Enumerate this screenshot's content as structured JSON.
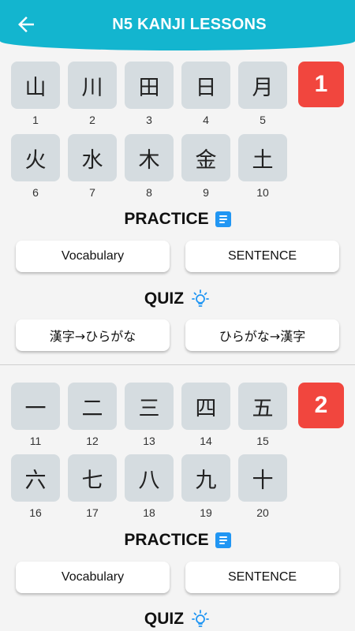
{
  "header": {
    "title": "N5 KANJI LESSONS",
    "back_icon": "arrow-left-icon",
    "color": "#13b5cf"
  },
  "lessons": [
    {
      "badge": "1",
      "kanji": [
        {
          "char": "山",
          "num": "1"
        },
        {
          "char": "川",
          "num": "2"
        },
        {
          "char": "田",
          "num": "3"
        },
        {
          "char": "日",
          "num": "4"
        },
        {
          "char": "月",
          "num": "5"
        },
        {
          "char": "火",
          "num": "6"
        },
        {
          "char": "水",
          "num": "7"
        },
        {
          "char": "木",
          "num": "8"
        },
        {
          "char": "金",
          "num": "9"
        },
        {
          "char": "土",
          "num": "10"
        }
      ],
      "practice_label": "PRACTICE",
      "vocab_label": "Vocabulary",
      "sentence_label": "SENTENCE",
      "quiz_label": "QUIZ",
      "quiz_kanji_to_kana": "漢字→ひらがな",
      "quiz_kana_to_kanji": "ひらがな→漢字"
    },
    {
      "badge": "2",
      "kanji": [
        {
          "char": "一",
          "num": "11"
        },
        {
          "char": "二",
          "num": "12"
        },
        {
          "char": "三",
          "num": "13"
        },
        {
          "char": "四",
          "num": "14"
        },
        {
          "char": "五",
          "num": "15"
        },
        {
          "char": "六",
          "num": "16"
        },
        {
          "char": "七",
          "num": "17"
        },
        {
          "char": "八",
          "num": "18"
        },
        {
          "char": "九",
          "num": "19"
        },
        {
          "char": "十",
          "num": "20"
        }
      ],
      "practice_label": "PRACTICE",
      "vocab_label": "Vocabulary",
      "sentence_label": "SENTENCE",
      "quiz_label": "QUIZ"
    }
  ],
  "colors": {
    "badge": "#f1463e",
    "card": "#d5dce0",
    "icon_blue": "#2196f3"
  }
}
